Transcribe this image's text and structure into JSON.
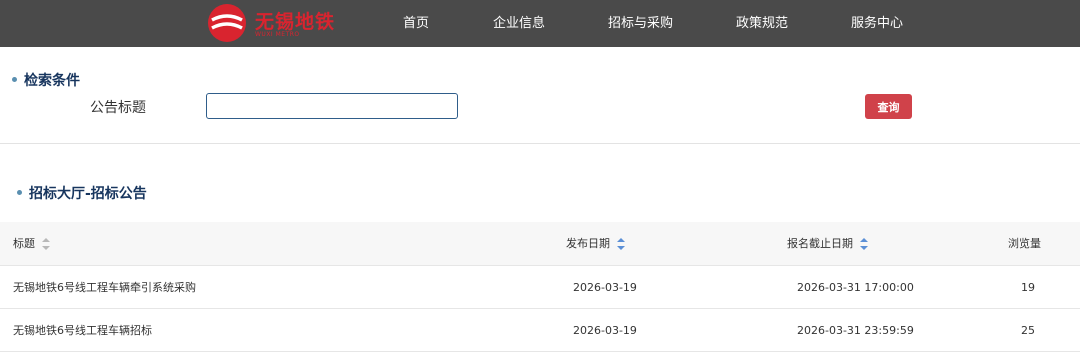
{
  "header": {
    "logo_text": "无锡地铁",
    "logo_sub": "WUXI METRO",
    "nav": [
      "首页",
      "企业信息",
      "招标与采购",
      "政策规范",
      "服务中心"
    ],
    "colors": {
      "bar": "#4a4a4a",
      "brand": "#d9242f"
    }
  },
  "search": {
    "section_title": "检索条件",
    "field_label": "公告标题",
    "input_value": "",
    "query_button": "查询"
  },
  "listing": {
    "section_title": "招标大厅-招标公告",
    "columns": [
      "标题",
      "发布日期",
      "报名截止日期",
      "浏览量"
    ],
    "rows": [
      {
        "title": "无锡地铁6号线工程车辆牵引系统采购",
        "publish_date": "2026-03-19",
        "deadline": "2026-03-31 17:00:00",
        "views": "19"
      },
      {
        "title": "无锡地铁6号线工程车辆招标",
        "publish_date": "2026-03-19",
        "deadline": "2026-03-31 23:59:59",
        "views": "25"
      }
    ]
  },
  "icons": {
    "sort": "sort-arrows-icon",
    "bullet": "bullet-dot-icon",
    "logo": "metro-logo-icon"
  }
}
